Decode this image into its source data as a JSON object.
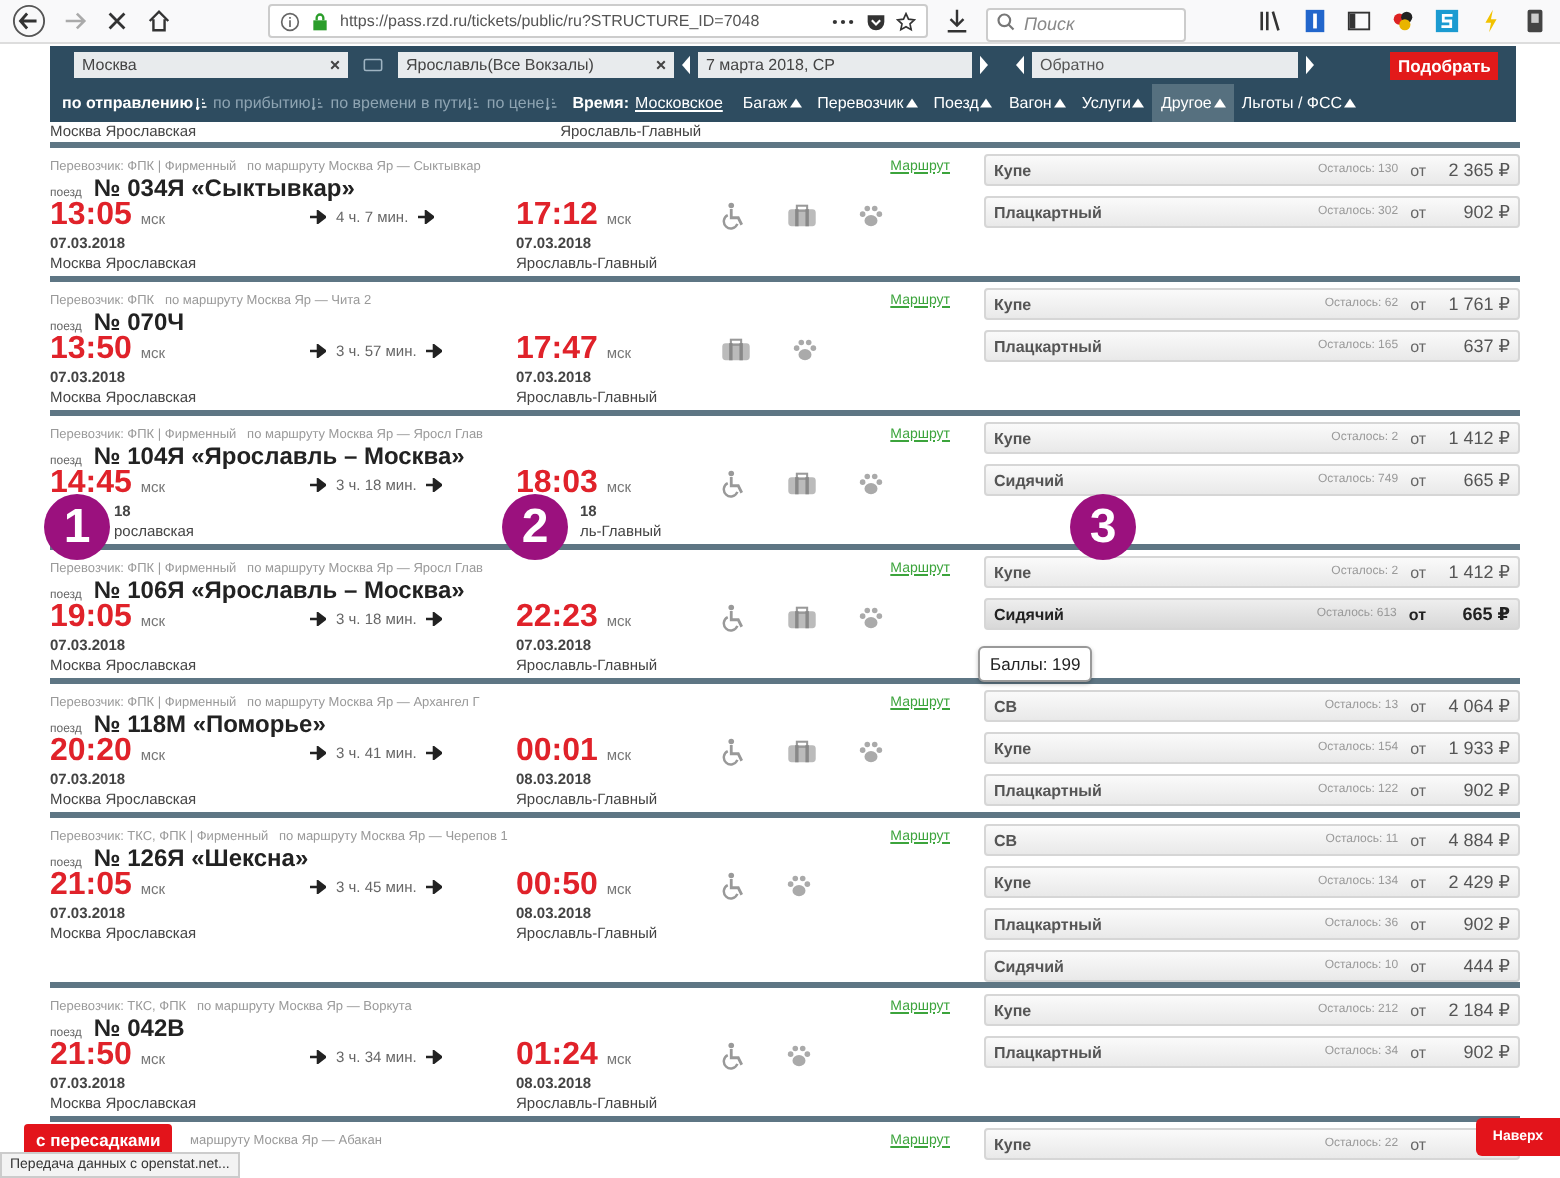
{
  "browser": {
    "url": "https://pass.rzd.ru/tickets/public/ru?STRUCTURE_ID=7048",
    "search_placeholder": "Поиск"
  },
  "search": {
    "from": "Москва",
    "to": "Ярославль(Все Вокзалы)",
    "date": "7 марта 2018, СР",
    "return_placeholder": "Обратно",
    "submit": "Подобрать"
  },
  "sort": [
    {
      "label": "по отправлению",
      "selected": true
    },
    {
      "label": "по прибытию",
      "selected": false
    },
    {
      "label": "по времени в пути",
      "selected": false
    },
    {
      "label": "по цене",
      "selected": false
    }
  ],
  "time_label": "Время:",
  "time_value": "Московское",
  "filters": [
    {
      "label": "Багаж",
      "selected": false
    },
    {
      "label": "Перевозчик",
      "selected": false
    },
    {
      "label": "Поезд",
      "selected": false
    },
    {
      "label": "Вагон",
      "selected": false
    },
    {
      "label": "Услуги",
      "selected": false
    },
    {
      "label": "Другое",
      "selected": true
    },
    {
      "label": "Льготы / ФСС",
      "selected": false
    }
  ],
  "partial_train": {
    "from_station": "Москва Ярославская",
    "to_station": "Ярославль-Главный"
  },
  "trains": [
    {
      "carrier": "Перевозчик: ФПК | Фирменный   по маршруту Москва Яр — Сыктывкар",
      "route_link": "Маршрут",
      "train_label": "поезд",
      "number": "№ 034Я «Сыктывкар»",
      "departure": {
        "time": "13:05",
        "zone": "мск",
        "date": "07.03.2018",
        "station": "Москва Ярославская"
      },
      "duration": "4 ч. 7 мин.",
      "arrival": {
        "time": "17:12",
        "zone": "мск",
        "date": "07.03.2018",
        "station": "Ярославль-Главный"
      },
      "amenities": [
        {
          "kind": "wheelchair"
        },
        {
          "kind": "luggage"
        },
        {
          "kind": "pets"
        }
      ],
      "classes": [
        {
          "name": "Купе",
          "remaining": "Осталось: 130",
          "from": "от",
          "price": "2 365 ₽",
          "selected": false
        },
        {
          "name": "Плацкартный",
          "remaining": "Осталось: 302",
          "from": "от",
          "price": "902 ₽",
          "selected": false
        }
      ]
    },
    {
      "carrier": "Перевозчик: ФПК   по маршруту Москва Яр — Чита 2",
      "route_link": "Маршрут",
      "train_label": "поезд",
      "number": "№ 070Ч",
      "departure": {
        "time": "13:50",
        "zone": "мск",
        "date": "07.03.2018",
        "station": "Москва Ярославская"
      },
      "duration": "3 ч. 57 мин.",
      "arrival": {
        "time": "17:47",
        "zone": "мск",
        "date": "07.03.2018",
        "station": "Ярославль-Главный"
      },
      "amenities": [
        {
          "kind": "luggage"
        },
        {
          "kind": "pets"
        }
      ],
      "classes": [
        {
          "name": "Купе",
          "remaining": "Осталось: 62",
          "from": "от",
          "price": "1 761 ₽",
          "selected": false
        },
        {
          "name": "Плацкартный",
          "remaining": "Осталось: 165",
          "from": "от",
          "price": "637 ₽",
          "selected": false
        }
      ]
    },
    {
      "carrier": "Перевозчик: ФПК | Фирменный   по маршруту Москва Яр — Яросл Глав",
      "route_link": "Маршрут",
      "train_label": "поезд",
      "number": "№ 104Я «Ярославль – Москва»",
      "departure": {
        "time": "14:45",
        "zone": "мск",
        "date": "18",
        "station": "рославская",
        "covered": true
      },
      "duration": "3 ч. 18 мин.",
      "arrival": {
        "time": "18:03",
        "zone": "мск",
        "date": "18",
        "station": "ль-Главный",
        "covered": true
      },
      "amenities": [
        {
          "kind": "wheelchair"
        },
        {
          "kind": "luggage"
        },
        {
          "kind": "pets"
        }
      ],
      "classes": [
        {
          "name": "Купе",
          "remaining": "Осталось: 2",
          "from": "от",
          "price": "1 412 ₽",
          "selected": false
        },
        {
          "name": "Сидячий",
          "remaining": "Осталось: 749",
          "from": "от",
          "price": "665 ₽",
          "selected": false
        }
      ]
    },
    {
      "carrier": "Перевозчик: ФПК | Фирменный   по маршруту Москва Яр — Яросл Глав",
      "route_link": "Маршрут",
      "train_label": "поезд",
      "number": "№ 106Я «Ярославль – Москва»",
      "departure": {
        "time": "19:05",
        "zone": "мск",
        "date": "07.03.2018",
        "station": "Москва Ярославская"
      },
      "duration": "3 ч. 18 мин.",
      "arrival": {
        "time": "22:23",
        "zone": "мск",
        "date": "07.03.2018",
        "station": "Ярославль-Главный"
      },
      "amenities": [
        {
          "kind": "wheelchair"
        },
        {
          "kind": "luggage"
        },
        {
          "kind": "pets"
        }
      ],
      "classes": [
        {
          "name": "Купе",
          "remaining": "Осталось: 2",
          "from": "от",
          "price": "1 412 ₽",
          "selected": false
        },
        {
          "name": "Сидячий",
          "remaining": "Осталось: 613",
          "from": "от",
          "price": "665 ₽",
          "selected": true
        }
      ]
    },
    {
      "carrier": "Перевозчик: ФПК | Фирменный   по маршруту Москва Яр — Архангел Г",
      "route_link": "Маршрут",
      "train_label": "поезд",
      "number": "№ 118М «Поморье»",
      "departure": {
        "time": "20:20",
        "zone": "мск",
        "date": "07.03.2018",
        "station": "Москва Ярославская"
      },
      "duration": "3 ч. 41 мин.",
      "arrival": {
        "time": "00:01",
        "zone": "мск",
        "date": "08.03.2018",
        "station": "Ярославль-Главный"
      },
      "amenities": [
        {
          "kind": "wheelchair"
        },
        {
          "kind": "luggage"
        },
        {
          "kind": "pets"
        }
      ],
      "classes": [
        {
          "name": "СВ",
          "remaining": "Осталось: 13",
          "from": "от",
          "price": "4 064 ₽",
          "selected": false
        },
        {
          "name": "Купе",
          "remaining": "Осталось: 154",
          "from": "от",
          "price": "1 933 ₽",
          "selected": false
        },
        {
          "name": "Плацкартный",
          "remaining": "Осталось: 122",
          "from": "от",
          "price": "902 ₽",
          "selected": false
        }
      ]
    },
    {
      "carrier": "Перевозчик: ТКС, ФПК | Фирменный   по маршруту Москва Яр — Черепов 1",
      "route_link": "Маршрут",
      "train_label": "поезд",
      "number": "№ 126Я «Шексна»",
      "departure": {
        "time": "21:05",
        "zone": "мск",
        "date": "07.03.2018",
        "station": "Москва Ярославская"
      },
      "duration": "3 ч. 45 мин.",
      "arrival": {
        "time": "00:50",
        "zone": "мск",
        "date": "08.03.2018",
        "station": "Ярославль-Главный"
      },
      "amenities": [
        {
          "kind": "wheelchair"
        },
        {
          "kind": "pets"
        }
      ],
      "classes": [
        {
          "name": "СВ",
          "remaining": "Осталось: 11",
          "from": "от",
          "price": "4 884 ₽",
          "selected": false
        },
        {
          "name": "Купе",
          "remaining": "Осталось: 134",
          "from": "от",
          "price": "2 429 ₽",
          "selected": false
        },
        {
          "name": "Плацкартный",
          "remaining": "Осталось: 36",
          "from": "от",
          "price": "902 ₽",
          "selected": false
        },
        {
          "name": "Сидячий",
          "remaining": "Осталось: 10",
          "from": "от",
          "price": "444 ₽",
          "selected": false
        }
      ]
    },
    {
      "carrier": "Перевозчик: ТКС, ФПК   по маршруту Москва Яр — Воркута",
      "route_link": "Маршрут",
      "train_label": "поезд",
      "number": "№ 042В",
      "departure": {
        "time": "21:50",
        "zone": "мск",
        "date": "07.03.2018",
        "station": "Москва Ярославская"
      },
      "duration": "3 ч. 34 мин.",
      "arrival": {
        "time": "01:24",
        "zone": "мск",
        "date": "08.03.2018",
        "station": "Ярославль-Главный"
      },
      "amenities": [
        {
          "kind": "wheelchair"
        },
        {
          "kind": "pets"
        }
      ],
      "classes": [
        {
          "name": "Купе",
          "remaining": "Осталось: 212",
          "from": "от",
          "price": "2 184 ₽",
          "selected": false
        },
        {
          "name": "Плацкартный",
          "remaining": "Осталось: 34",
          "from": "от",
          "price": "902 ₽",
          "selected": false
        }
      ]
    }
  ],
  "last_train": {
    "carrier": "маршруту Москва Яр — Абакан",
    "route_link": "Маршрут",
    "classes": [
      {
        "name": "Купе",
        "remaining": "Осталось: 22",
        "from": "от",
        "selected": false
      }
    ]
  },
  "annotations": [
    {
      "label": "1"
    },
    {
      "label": "2"
    },
    {
      "label": "3"
    }
  ],
  "tooltip": "Баллы: 199",
  "transfers_button": "с пересадками",
  "top_button": "Наверх",
  "status_bar": "Передача данных с openstat.net..."
}
